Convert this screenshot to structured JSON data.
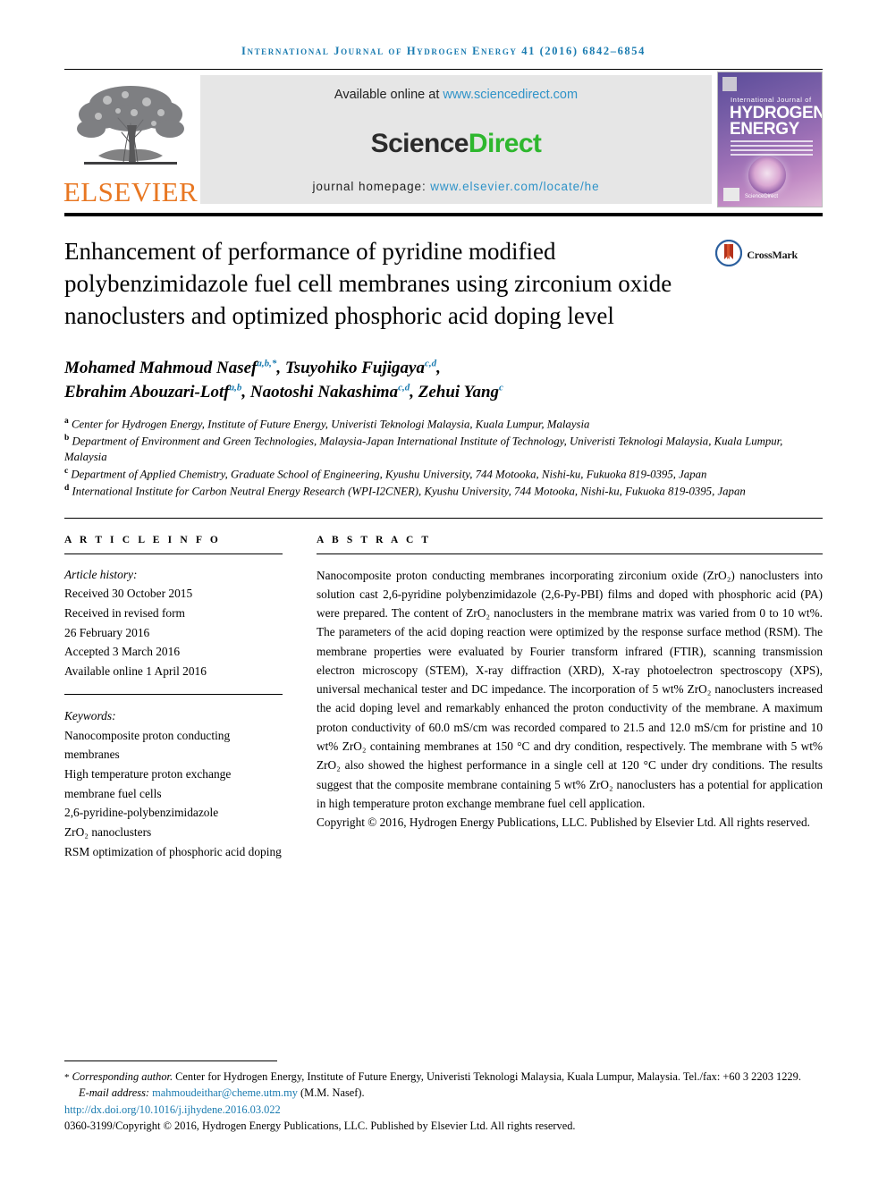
{
  "running_head": "International Journal of Hydrogen Energy 41 (2016) 6842–6854",
  "masthead": {
    "publisher_name": "ELSEVIER",
    "available_prefix": "Available online at ",
    "available_link": "www.sciencedirect.com",
    "sciencedirect_part1": "Science",
    "sciencedirect_part2": "Direct",
    "homepage_prefix": "journal homepage: ",
    "homepage_link": "www.elsevier.com/locate/he",
    "cover": {
      "line_small": "International Journal of",
      "line_big_1": "HYDROGEN",
      "line_big_2": "ENERGY",
      "brand": "ScienceDirect"
    }
  },
  "crossmark": {
    "label": "CrossMark"
  },
  "title": "Enhancement of performance of pyridine modified polybenzimidazole fuel cell membranes using zirconium oxide nanoclusters and optimized phosphoric acid doping level",
  "authors": [
    {
      "name": "Mohamed Mahmoud Nasef",
      "marks": "a,b,*",
      "sep": ", "
    },
    {
      "name": "Tsuyohiko Fujigaya",
      "marks": "c,d",
      "sep": ","
    },
    {
      "name": "Ebrahim Abouzari-Lotf",
      "marks": "a,b",
      "sep": ", "
    },
    {
      "name": "Naotoshi Nakashima",
      "marks": "c,d",
      "sep": ", "
    },
    {
      "name": "Zehui Yang",
      "marks": "c",
      "sep": ""
    }
  ],
  "affiliations": [
    {
      "mark": "a",
      "text": "Center for Hydrogen Energy, Institute of Future Energy, Univeristi Teknologi Malaysia, Kuala Lumpur, Malaysia"
    },
    {
      "mark": "b",
      "text": "Department of Environment and Green Technologies, Malaysia-Japan International Institute of Technology, Univeristi Teknologi Malaysia, Kuala Lumpur, Malaysia"
    },
    {
      "mark": "c",
      "text": "Department of Applied Chemistry, Graduate School of Engineering, Kyushu University, 744 Motooka, Nishi-ku, Fukuoka 819-0395, Japan"
    },
    {
      "mark": "d",
      "text": "International Institute for Carbon Neutral Energy Research (WPI-I2CNER), Kyushu University, 744 Motooka, Nishi-ku, Fukuoka 819-0395, Japan"
    }
  ],
  "article_info": {
    "heading": "A R T I C L E   I N F O",
    "history_label": "Article history:",
    "history": [
      "Received 30 October 2015",
      "Received in revised form",
      "26 February 2016",
      "Accepted 3 March 2016",
      "Available online 1 April 2016"
    ],
    "keywords_label": "Keywords:",
    "keywords": [
      "Nanocomposite proton conducting membranes",
      "High temperature proton exchange membrane fuel cells",
      "2,6-pyridine-polybenzimidazole",
      "ZrO₂ nanoclusters",
      "RSM optimization of phosphoric acid doping"
    ]
  },
  "abstract": {
    "heading": "A B S T R A C T",
    "body": "Nanocomposite proton conducting membranes incorporating zirconium oxide (ZrO₂) nanoclusters into solution cast 2,6-pyridine polybenzimidazole (2,6-Py-PBI) films and doped with phosphoric acid (PA) were prepared. The content of ZrO₂ nanoclusters in the membrane matrix was varied from 0 to 10 wt%. The parameters of the acid doping reaction were optimized by the response surface method (RSM). The membrane properties were evaluated by Fourier transform infrared (FTIR), scanning transmission electron microscopy (STEM), X-ray diffraction (XRD), X-ray photoelectron spectroscopy (XPS), universal mechanical tester and DC impedance. The incorporation of 5 wt% ZrO₂ nanoclusters increased the acid doping level and remarkably enhanced the proton conductivity of the membrane. A maximum proton conductivity of 60.0 mS/cm was recorded compared to 21.5 and 12.0 mS/cm for pristine and 10 wt% ZrO₂ containing membranes at 150 °C and dry condition, respectively. The membrane with 5 wt% ZrO₂ also showed the highest performance in a single cell at 120 °C under dry conditions. The results suggest that the composite membrane containing 5 wt% ZrO₂ nanoclusters has a potential for application in high temperature proton exchange membrane fuel cell application.",
    "copyright": "Copyright © 2016, Hydrogen Energy Publications, LLC. Published by Elsevier Ltd. All rights reserved."
  },
  "footer": {
    "corresponding_star": "*",
    "corresponding_label": "Corresponding author.",
    "corresponding_address": " Center for Hydrogen Energy, Institute of Future Energy, Univeristi Teknologi Malaysia, Kuala Lumpur, Malaysia. Tel./fax: +60 3 2203 1229.",
    "email_label": "E-mail address: ",
    "email": "mahmoudeithar@cheme.utm.my",
    "email_owner": " (M.M. Nasef).",
    "doi": "http://dx.doi.org/10.1016/j.ijhydene.2016.03.022",
    "issn_line": "0360-3199/Copyright © 2016, Hydrogen Energy Publications, LLC. Published by Elsevier Ltd. All rights reserved."
  },
  "colors": {
    "link_blue": "#1a7bb0",
    "sd_blue": "#2f93c8",
    "sd_green": "#2eb72e",
    "elsevier_orange": "#E87722"
  }
}
